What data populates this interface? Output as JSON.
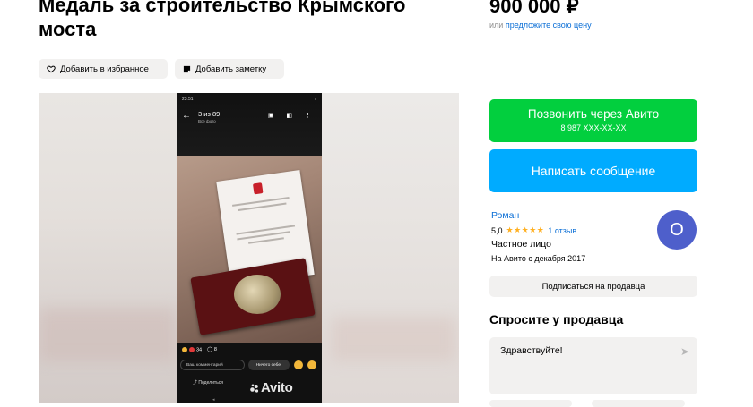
{
  "listing": {
    "title": "Медаль за строительство Крымского моста",
    "price": "900 000 ₽",
    "price_prefix": "или",
    "offer_price_link": "предложите свою цену"
  },
  "actions": {
    "favorite": "Добавить в избранное",
    "note": "Добавить заметку"
  },
  "photo": {
    "status_time": "23:51",
    "status_signal": "ₗₗ",
    "counter": "3 из 89",
    "all_photos": "Все фото",
    "likes": "34",
    "comments": "8",
    "comment_placeholder": "Ваш комментарий",
    "reply_button": "Ничего себе!",
    "share": "Поделиться",
    "watermark": "Avito"
  },
  "contact": {
    "call_label": "Позвонить через Авито",
    "call_phone": "8 987 XXX-XX-XX",
    "message_label": "Написать сообщение"
  },
  "seller": {
    "name": "Роман",
    "rating": "5,0",
    "stars": "★★★★★",
    "reviews": "1 отзыв",
    "type": "Частное лицо",
    "since": "На Авито с декабря 2017",
    "avatar_letter": "О",
    "avatar_color": "#4e5fcb",
    "subscribe_label": "Подписаться на продавца"
  },
  "ask": {
    "heading": "Спросите у продавца",
    "message": "Здравствуйте!"
  },
  "colors": {
    "call_green": "#02cf3e",
    "message_blue": "#00abff",
    "link_blue": "#0a6ed6",
    "star_orange": "#ffb021"
  }
}
